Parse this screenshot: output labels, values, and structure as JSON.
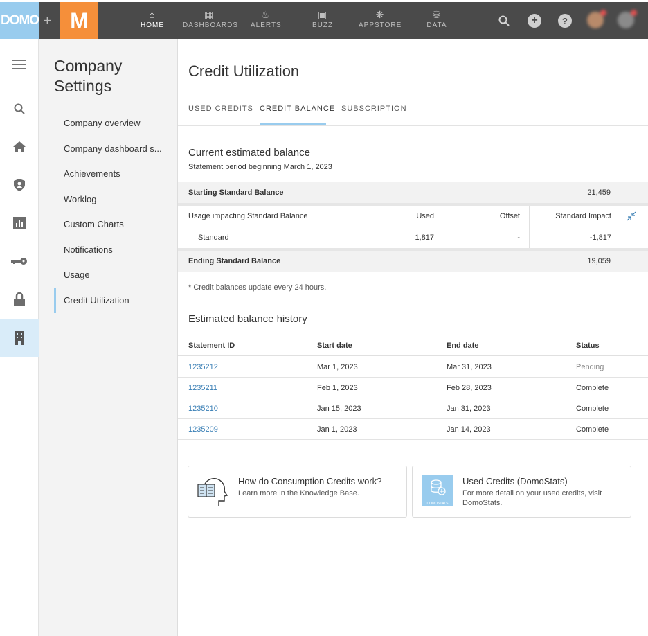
{
  "brand": {
    "logo_text": "DOMO",
    "separator": "+",
    "tile_letter": "M"
  },
  "topnav": [
    {
      "id": "home",
      "label": "HOME",
      "icon": "home-icon",
      "active": true
    },
    {
      "id": "dashboards",
      "label": "DASHBOARDS",
      "icon": "dashboards-icon"
    },
    {
      "id": "alerts",
      "label": "ALERTS",
      "icon": "bell-icon"
    },
    {
      "id": "buzz",
      "label": "BUZZ",
      "icon": "chat-icon"
    },
    {
      "id": "appstore",
      "label": "APPSTORE",
      "icon": "appstore-icon"
    },
    {
      "id": "data",
      "label": "DATA",
      "icon": "database-icon"
    }
  ],
  "sidebar": {
    "title": "Company Settings",
    "items": [
      {
        "label": "Company overview"
      },
      {
        "label": "Company dashboard s..."
      },
      {
        "label": "Achievements"
      },
      {
        "label": "Worklog"
      },
      {
        "label": "Custom Charts"
      },
      {
        "label": "Notifications"
      },
      {
        "label": "Usage"
      },
      {
        "label": "Credit Utilization",
        "active": true
      }
    ]
  },
  "page": {
    "title": "Credit Utilization",
    "tabs": [
      {
        "label": "USED CREDITS"
      },
      {
        "label": "CREDIT BALANCE",
        "active": true
      },
      {
        "label": "SUBSCRIPTION"
      }
    ]
  },
  "balance": {
    "title": "Current estimated balance",
    "subtitle": "Statement period beginning March 1, 2023",
    "starting_label": "Starting Standard Balance",
    "starting_value": "21,459",
    "usage_header": {
      "label": "Usage impacting Standard Balance",
      "used": "Used",
      "offset": "Offset",
      "impact": "Standard Impact"
    },
    "usage_row": {
      "label": "Standard",
      "used": "1,817",
      "offset": "-",
      "impact": "-1,817"
    },
    "ending_label": "Ending Standard Balance",
    "ending_value": "19,059",
    "note": "* Credit balances update every 24 hours."
  },
  "history": {
    "title": "Estimated balance history",
    "columns": [
      "Statement ID",
      "Start date",
      "End date",
      "Status"
    ],
    "rows": [
      {
        "id": "1235212",
        "start": "Mar 1, 2023",
        "end": "Mar 31, 2023",
        "status": "Pending"
      },
      {
        "id": "1235211",
        "start": "Feb 1, 2023",
        "end": "Feb 28, 2023",
        "status": "Complete"
      },
      {
        "id": "1235210",
        "start": "Jan 15, 2023",
        "end": "Jan 31, 2023",
        "status": "Complete"
      },
      {
        "id": "1235209",
        "start": "Jan 1, 2023",
        "end": "Jan 14, 2023",
        "status": "Complete"
      }
    ]
  },
  "cards": [
    {
      "title": "How do Consumption Credits work?",
      "desc": "Learn more in the Knowledge Base.",
      "icon": "knowledge-head-icon"
    },
    {
      "title": "Used Credits (DomoStats)",
      "desc": "For more detail on your used credits, visit DomoStats.",
      "icon": "domostats-icon",
      "tile_text": "DOMOSTATS"
    }
  ],
  "colors": {
    "accent": "#99ccee",
    "topbar": "#4a4a4a",
    "brand_orange": "#f58f3a",
    "link": "#3a7fb5"
  }
}
